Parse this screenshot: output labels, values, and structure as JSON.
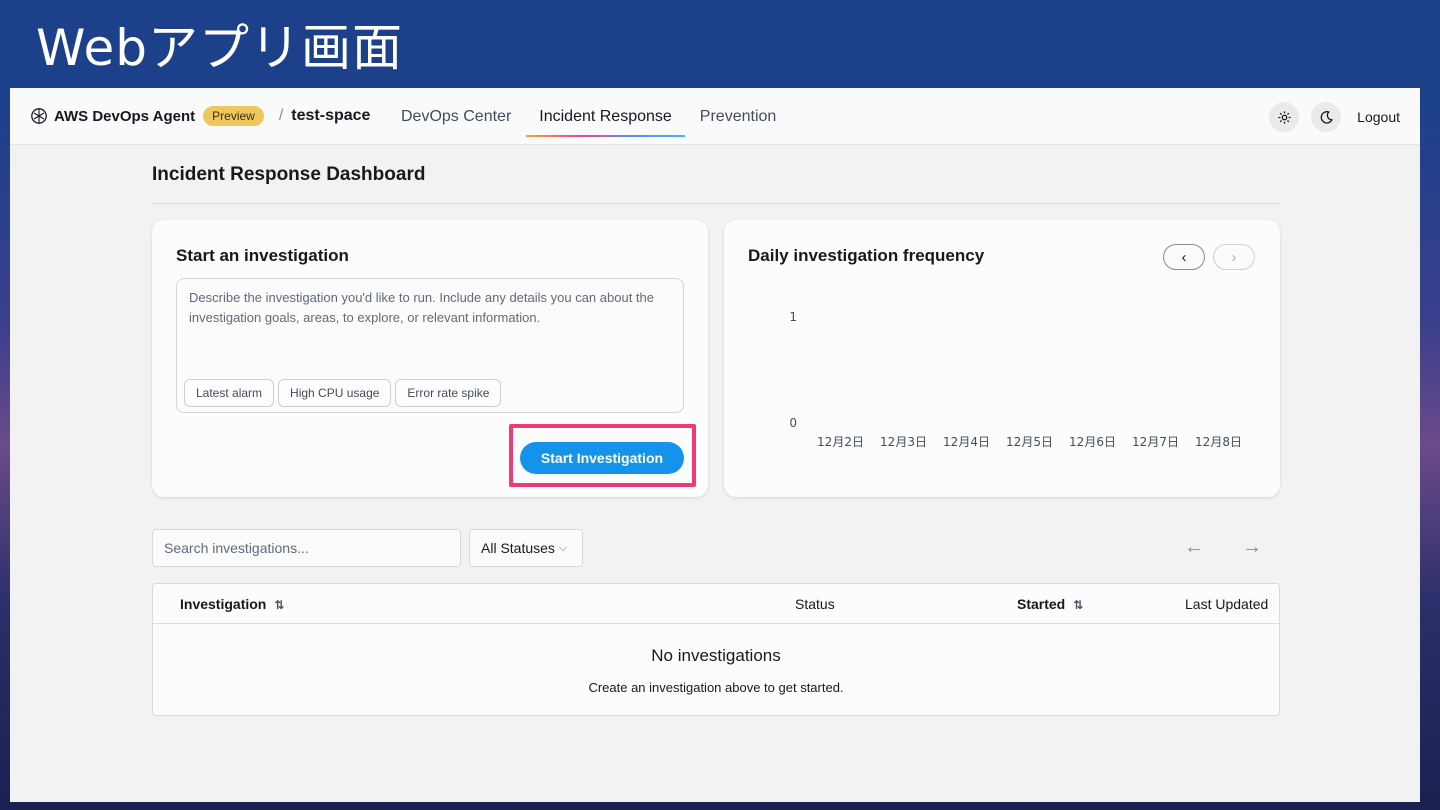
{
  "slide": {
    "title": "Webアプリ画面"
  },
  "header": {
    "app_name": "AWS DevOps Agent",
    "badge": "Preview",
    "breadcrumb_sep": "/",
    "space": "test-space",
    "nav": [
      {
        "label": "DevOps Center",
        "active": false
      },
      {
        "label": "Incident Response",
        "active": true
      },
      {
        "label": "Prevention",
        "active": false
      }
    ],
    "settings_icon": "gear-icon",
    "theme_icon": "moon-icon",
    "logout": "Logout"
  },
  "page": {
    "title": "Incident Response Dashboard"
  },
  "investigation_card": {
    "title": "Start an investigation",
    "placeholder": "Describe the investigation you'd like to run. Include any details you can about the investigation goals, areas, to explore, or relevant information.",
    "chips": [
      "Latest alarm",
      "High CPU usage",
      "Error rate spike"
    ],
    "button": "Start Investigation",
    "highlight_color": "#f03a78"
  },
  "chart_card": {
    "title": "Daily investigation frequency",
    "prev": "‹",
    "next": "›"
  },
  "chart_data": {
    "type": "bar",
    "categories": [
      "12月2日",
      "12月3日",
      "12月4日",
      "12月5日",
      "12月6日",
      "12月7日",
      "12月8日"
    ],
    "values": [
      0,
      0,
      0,
      0,
      0,
      0,
      0
    ],
    "yticks": [
      "0",
      "1"
    ],
    "ylim": [
      0,
      1
    ],
    "grid": false
  },
  "filters": {
    "search_placeholder": "Search investigations...",
    "status_value": "All Statuses",
    "prev_page": "←",
    "next_page": "→"
  },
  "table": {
    "columns": [
      {
        "label": "Investigation",
        "sortable": true
      },
      {
        "label": "Status",
        "sortable": false
      },
      {
        "label": "Started",
        "sortable": true
      },
      {
        "label": "Last Updated",
        "sortable": false
      }
    ],
    "sort_glyph": "⇅",
    "empty_title": "No investigations",
    "empty_subtitle": "Create an investigation above to get started."
  },
  "colors": {
    "slide_bg": "#1c418a",
    "primary_button": "#1592ea",
    "preview_badge": "#f0c75e"
  }
}
